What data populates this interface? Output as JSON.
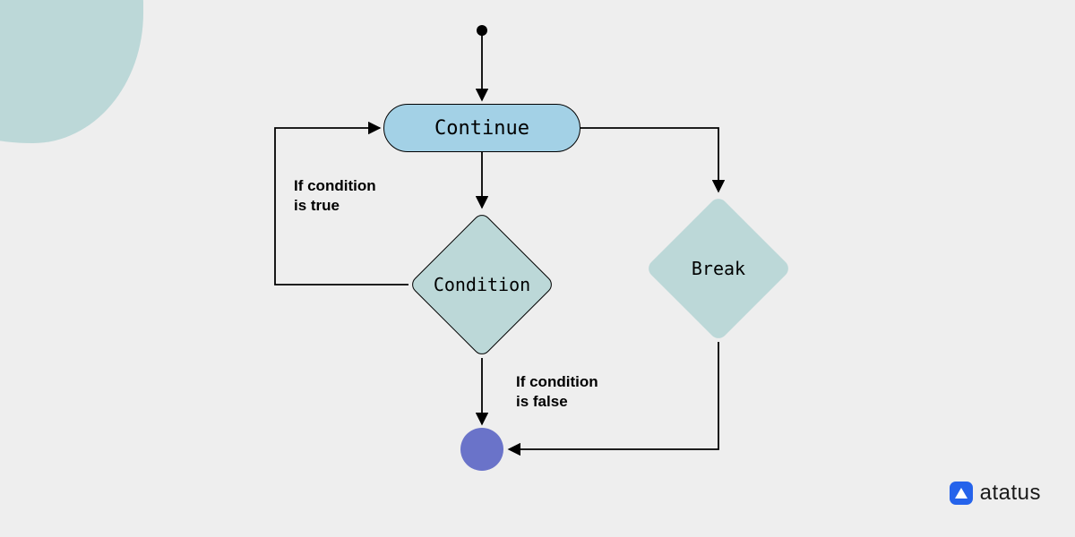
{
  "diagram": {
    "nodes": {
      "continue": {
        "label": "Continue",
        "type": "pill"
      },
      "condition": {
        "label": "Condition",
        "type": "diamond"
      },
      "break": {
        "label": "Break",
        "type": "diamond"
      },
      "start": {
        "type": "start"
      },
      "end": {
        "type": "end"
      }
    },
    "edges": {
      "true_branch": {
        "label": "If condition\nis true"
      },
      "false_branch": {
        "label": "If condition\nis false"
      }
    }
  },
  "brand": {
    "name": "atatus"
  },
  "colors": {
    "pill_fill": "#a3d1e6",
    "diamond_fill": "#bcd8d8",
    "end_fill": "#6a73c9",
    "blob_fill": "#bcd8d8",
    "brand_blue": "#2563eb",
    "bg": "#eeeeee"
  }
}
